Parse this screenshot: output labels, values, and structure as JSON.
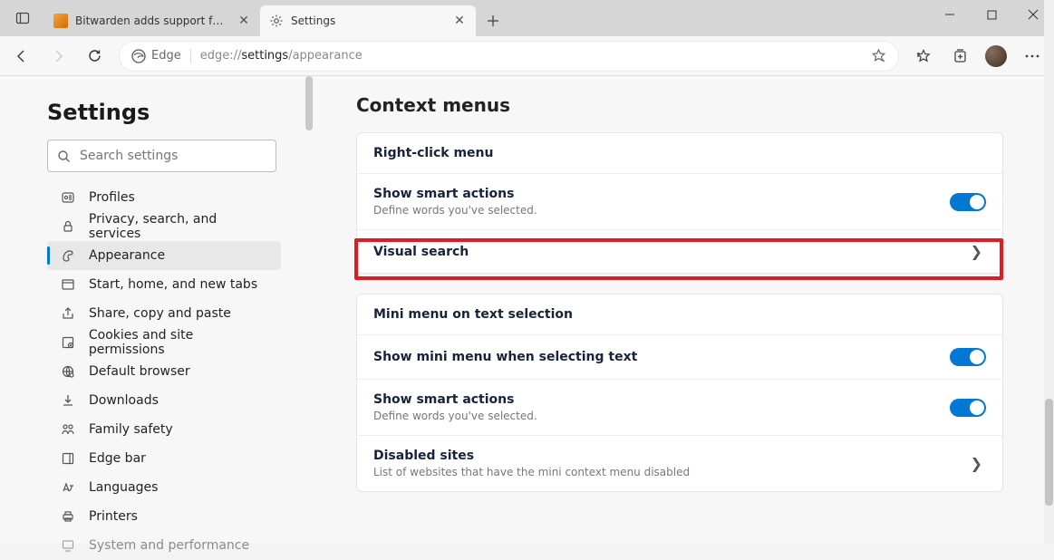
{
  "window": {
    "tabs": [
      {
        "label": "Bitwarden adds support for Simp",
        "active": false
      },
      {
        "label": "Settings",
        "active": true
      }
    ]
  },
  "toolbar": {
    "site_label": "Edge",
    "url_prefix": "edge://",
    "url_mid": "settings",
    "url_suffix": "/appearance"
  },
  "sidebar": {
    "title": "Settings",
    "search_placeholder": "Search settings",
    "items": [
      {
        "label": "Profiles"
      },
      {
        "label": "Privacy, search, and services"
      },
      {
        "label": "Appearance"
      },
      {
        "label": "Start, home, and new tabs"
      },
      {
        "label": "Share, copy and paste"
      },
      {
        "label": "Cookies and site permissions"
      },
      {
        "label": "Default browser"
      },
      {
        "label": "Downloads"
      },
      {
        "label": "Family safety"
      },
      {
        "label": "Edge bar"
      },
      {
        "label": "Languages"
      },
      {
        "label": "Printers"
      },
      {
        "label": "System and performance"
      }
    ],
    "active_index": 2
  },
  "page": {
    "section_title": "Context menus",
    "card1": {
      "header": "Right-click menu",
      "row1_title": "Show smart actions",
      "row1_desc": "Define words you've selected.",
      "row2_title": "Visual search"
    },
    "card2": {
      "header": "Mini menu on text selection",
      "row1_title": "Show mini menu when selecting text",
      "row2_title": "Show smart actions",
      "row2_desc": "Define words you've selected.",
      "row3_title": "Disabled sites",
      "row3_desc": "List of websites that have the mini context menu disabled"
    }
  }
}
